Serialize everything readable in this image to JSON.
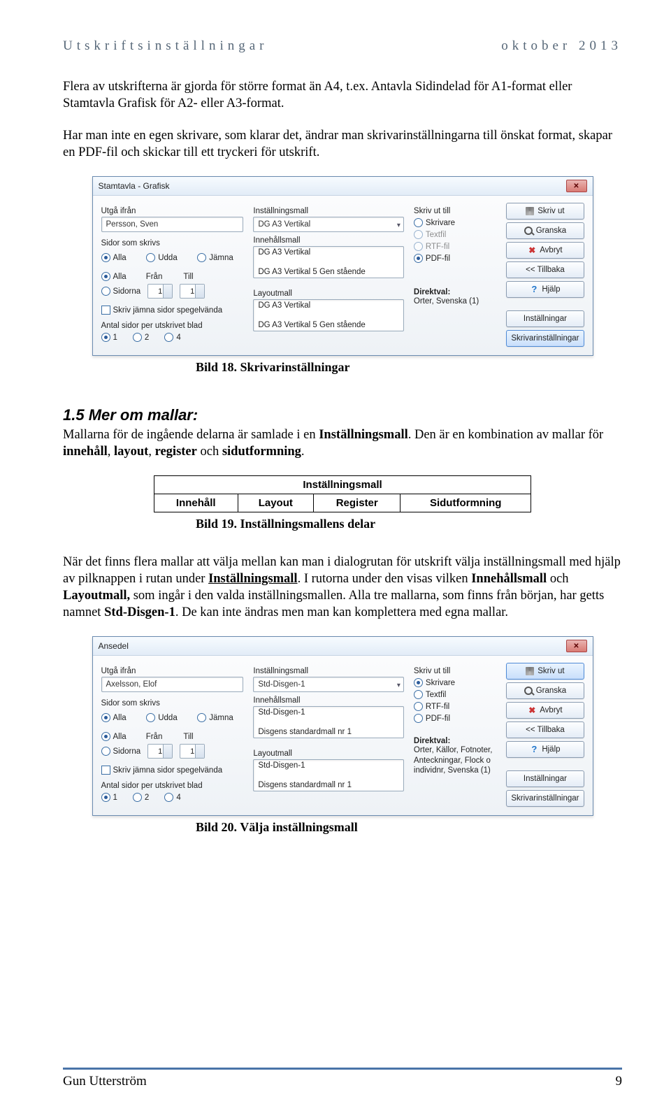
{
  "header": {
    "left": "Utskriftsinställningar",
    "right": "oktober 2013"
  },
  "para1": {
    "t1": "Flera av utskrifterna är gjorda för större format än A4, t.ex. Antavla Sidindelad för A1-format eller Stamtavla Grafisk för A2- eller A3-format.",
    "t2": "Har man inte en egen skrivare, som klarar det, ändrar man skrivarinställningarna till önskat format, skapar en PDF-fil och skickar till ett tryckeri för utskrift."
  },
  "dlg1": {
    "title": "Stamtavla - Grafisk",
    "utga_lbl": "Utgå ifrån",
    "utga_val": "Persson, Sven",
    "sidor_lbl": "Sidor som skrivs",
    "alla": "Alla",
    "udda": "Udda",
    "jamna": "Jämna",
    "fran": "Från",
    "till": "Till",
    "sidorna": "Sidorna",
    "spegel": "Skriv jämna sidor spegelvända",
    "antal_lbl": "Antal sidor per utskrivet blad",
    "n1": "1",
    "n2": "2",
    "n4": "4",
    "inst_lbl": "Inställningsmall",
    "inst_val": "DG A3 Vertikal",
    "inne_lbl": "Innehållsmall",
    "inne_v1": "DG A3 Vertikal",
    "inne_v2": "DG A3 Vertikal 5 Gen stående",
    "layout_lbl": "Layoutmall",
    "layout_v1": "DG A3 Vertikal",
    "layout_v2": "DG A3 Vertikal 5 Gen stående",
    "skriv_ut_till": "Skriv ut till",
    "r_skrivare": "Skrivare",
    "r_textfil": "Textfil",
    "r_rtf": "RTF-fil",
    "r_pdf": "PDF-fil",
    "direkt_h": "Direktval:",
    "direkt_t": "Orter, Svenska (1)",
    "b_skriv": "Skriv ut",
    "b_granska": "Granska",
    "b_avbryt": "Avbryt",
    "b_tillbaka": "<< Tillbaka",
    "b_hjalp": "Hjälp",
    "b_inst": "Inställningar",
    "b_skrivinst": "Skrivarinställningar"
  },
  "cap1": "Bild 18. Skrivarinställningar",
  "h2": "1.5  Mer om mallar:",
  "para2": {
    "a": "Mallarna för de ingående delarna är samlade i en ",
    "b": "Inställningsmall",
    "c": ". Den är en kombination av mallar för ",
    "d": "innehåll",
    "e": ", ",
    "f": "layout",
    "g": ", ",
    "h": "register",
    "i": " och ",
    "j": "sidutformning",
    "k": "."
  },
  "tbl": {
    "head": "Inställningsmall",
    "c1": "Innehåll",
    "c2": "Layout",
    "c3": "Register",
    "c4": "Sidutformning"
  },
  "cap2": "Bild 19. Inställningsmallens delar",
  "para3": {
    "a": "När det finns flera mallar att välja mellan kan man i dialogrutan för utskrift välja inställningsmall med hjälp av pilknappen i rutan under ",
    "b": "Inställningsmall",
    "c": ". I rutorna under den visas vilken ",
    "d": "Innehållsmall",
    "e": " och ",
    "f": "Layoutmall,",
    "g": " som ingår i den valda inställningsmallen. Alla tre mallarna, som finns från början, har getts namnet ",
    "h": "Std-Disgen-1",
    "i": ". De kan inte ändras men man kan komplettera med egna mallar."
  },
  "dlg2": {
    "title": "Ansedel",
    "utga_val": "Axelsson, Elof",
    "inst_val": "Std-Disgen-1",
    "inne_v1": "Std-Disgen-1",
    "inne_v2": "Disgens standardmall nr 1",
    "layout_v1": "Std-Disgen-1",
    "layout_v2": "Disgens standardmall nr 1",
    "direkt_t": "Orter, Källor, Fotnoter, Anteckningar, Flock o individnr, Svenska (1)"
  },
  "cap3": "Bild 20. Välja inställningsmall",
  "footer": {
    "left": "Gun Utterström",
    "right": "9"
  }
}
